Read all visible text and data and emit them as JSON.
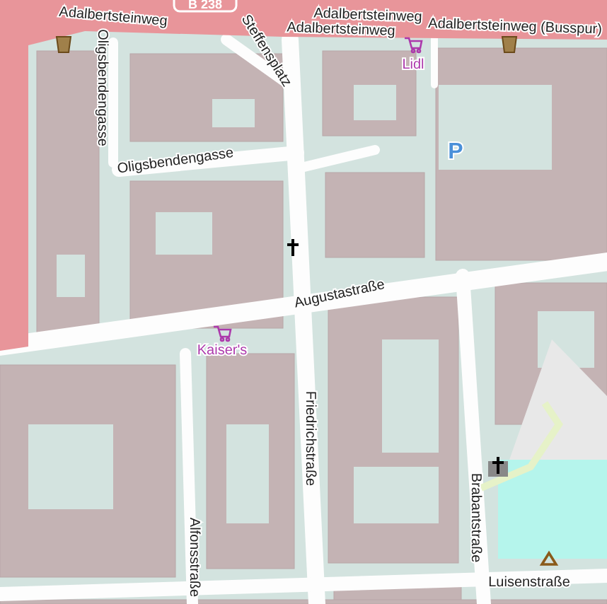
{
  "map": {
    "road_shield": "B 238",
    "labels": [
      {
        "kind": "street",
        "text": "Adalbertsteinweg"
      },
      {
        "kind": "street",
        "text": "Adalbertsteinweg"
      },
      {
        "kind": "street",
        "text": "Adalbertsteinweg"
      },
      {
        "kind": "street",
        "text": "Adalbertsteinweg (Busspur)"
      },
      {
        "kind": "street",
        "text": "Oligsbendengasse"
      },
      {
        "kind": "street",
        "text": "Steffensplatz"
      },
      {
        "kind": "street",
        "text": "Oligsbendengasse"
      },
      {
        "kind": "street",
        "text": "Augustastraße"
      },
      {
        "kind": "street",
        "text": "Friedrichstraße"
      },
      {
        "kind": "street",
        "text": "Alfonsstraße"
      },
      {
        "kind": "street",
        "text": "Brabantstraße"
      },
      {
        "kind": "street",
        "text": "Luisenstraße"
      },
      {
        "kind": "parking",
        "text": "P"
      },
      {
        "kind": "shop",
        "text": "Lidl"
      },
      {
        "kind": "shop",
        "text": "Kaiser's"
      }
    ]
  }
}
